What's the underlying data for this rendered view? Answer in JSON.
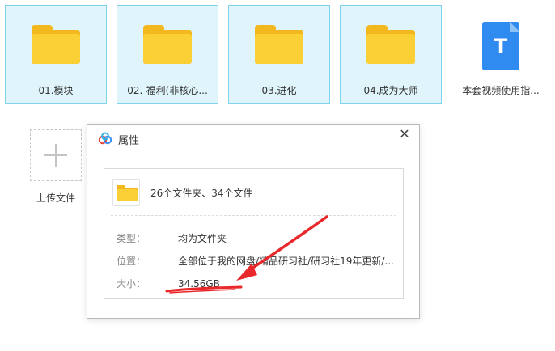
{
  "files": [
    {
      "label": "01.模块",
      "icon": "folder-icon"
    },
    {
      "label": "02.-福利(非核心...",
      "icon": "folder-icon"
    },
    {
      "label": "03.进化",
      "icon": "folder-icon"
    },
    {
      "label": "04.成为大师",
      "icon": "folder-icon"
    },
    {
      "label": "本套视频使用指...",
      "icon": "text-doc-icon"
    }
  ],
  "upload": {
    "label": "上传文件",
    "icon": "plus-icon"
  },
  "dialog": {
    "title": "属性",
    "close": "✕",
    "summary": "26个文件夹、34个文件",
    "type_label": "类型：",
    "type_value": "均为文件夹",
    "location_label": "位置：",
    "location_value": "全部位于我的网盘/精品研习社/研习社19年更新/...",
    "size_label": "大小：",
    "size_value": "34.56GB"
  },
  "colors": {
    "selection_bg": "#dff4fb",
    "selection_border": "#7fd3ea",
    "folder_yellow": "#fbcf36",
    "doc_blue": "#2f8bf0",
    "annotation_red": "#e8282b"
  }
}
